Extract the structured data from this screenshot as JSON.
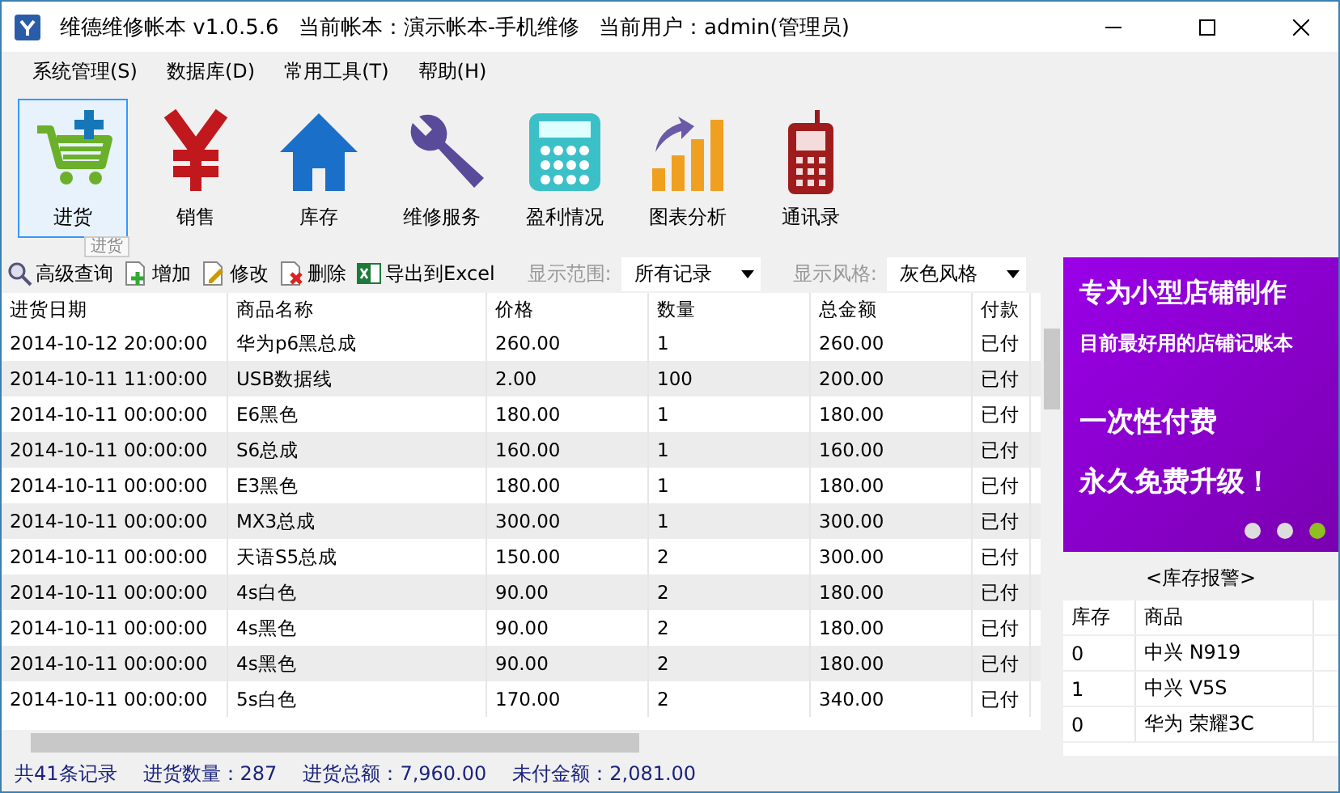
{
  "window": {
    "app_title": "维德维修帐本   v1.0.5.6",
    "account": "当前帐本：演示帐本-手机维修",
    "user": "当前用户：admin(管理员)"
  },
  "menu": [
    "系统管理(S)",
    "数据库(D)",
    "常用工具(T)",
    "帮助(H)"
  ],
  "toolbar": [
    {
      "label": "进货",
      "kind": "cart",
      "selected": true
    },
    {
      "label": "销售",
      "kind": "yen",
      "selected": false
    },
    {
      "label": "库存",
      "kind": "house",
      "selected": false
    },
    {
      "label": "维修服务",
      "kind": "wrench",
      "selected": false
    },
    {
      "label": "盈利情况",
      "kind": "calculator",
      "selected": false
    },
    {
      "label": "图表分析",
      "kind": "bars",
      "selected": false
    },
    {
      "label": "通讯录",
      "kind": "phone",
      "selected": false
    }
  ],
  "tooltip": "进货",
  "actions": [
    {
      "label": "高级查询",
      "kind": "search"
    },
    {
      "label": "增加",
      "kind": "add"
    },
    {
      "label": "修改",
      "kind": "edit"
    },
    {
      "label": "删除",
      "kind": "delete"
    },
    {
      "label": "导出到Excel",
      "kind": "excel"
    }
  ],
  "filters": [
    {
      "label": "显示范围:",
      "value": "所有记录"
    },
    {
      "label": "显示风格:",
      "value": "灰色风格"
    }
  ],
  "table": {
    "columns": [
      "进货日期",
      "商品名称",
      "价格",
      "数量",
      "总金额",
      "付款"
    ],
    "rows": [
      [
        "2014-10-12 20:00:00",
        "华为p6黑总成",
        "260.00",
        "1",
        "260.00",
        "已付"
      ],
      [
        "2014-10-11 11:00:00",
        "USB数据线",
        "2.00",
        "100",
        "200.00",
        "已付"
      ],
      [
        "2014-10-11 00:00:00",
        "E6黑色",
        "180.00",
        "1",
        "180.00",
        "已付"
      ],
      [
        "2014-10-11 00:00:00",
        "S6总成",
        "160.00",
        "1",
        "160.00",
        "已付"
      ],
      [
        "2014-10-11 00:00:00",
        "E3黑色",
        "180.00",
        "1",
        "180.00",
        "已付"
      ],
      [
        "2014-10-11 00:00:00",
        "MX3总成",
        "300.00",
        "1",
        "300.00",
        "已付"
      ],
      [
        "2014-10-11 00:00:00",
        "天语S5总成",
        "150.00",
        "2",
        "300.00",
        "已付"
      ],
      [
        "2014-10-11 00:00:00",
        "4s白色",
        "90.00",
        "2",
        "180.00",
        "已付"
      ],
      [
        "2014-10-11 00:00:00",
        "4s黑色",
        "90.00",
        "2",
        "180.00",
        "已付"
      ],
      [
        "2014-10-11 00:00:00",
        "4s黑色",
        "90.00",
        "2",
        "180.00",
        "已付"
      ],
      [
        "2014-10-11 00:00:00",
        "5s白色",
        "170.00",
        "2",
        "340.00",
        "已付"
      ]
    ]
  },
  "status_bar": [
    "共41条记录",
    "进货数量：287",
    "进货总额：7,960.00",
    "未付金额：2,081.00"
  ],
  "ad": {
    "lines": [
      "专为小型店铺制作",
      "目前最好用的店铺记账本",
      "一次性付费",
      "永久免费升级！"
    ],
    "dots": [
      {
        "selected": false
      },
      {
        "selected": false
      },
      {
        "selected": true
      }
    ]
  },
  "stock_alert": {
    "title": "<库存报警>",
    "columns": [
      "库存",
      "商品"
    ],
    "rows": [
      [
        "0",
        "中兴 N919"
      ],
      [
        "1",
        "中兴 V5S"
      ],
      [
        "0",
        "华为 荣耀3C"
      ]
    ]
  }
}
